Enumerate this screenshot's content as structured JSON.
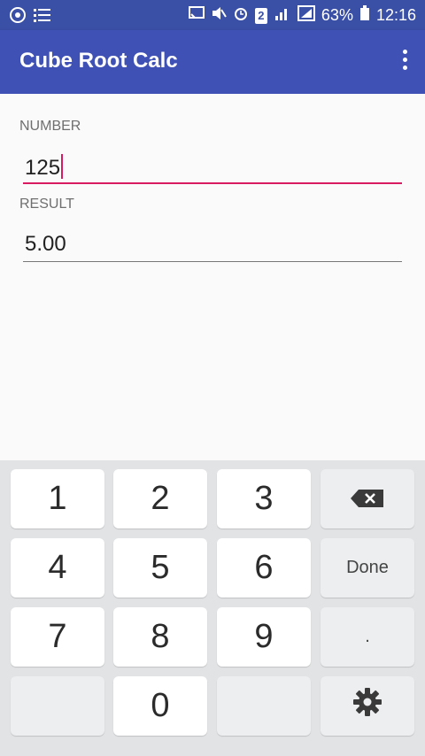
{
  "status_bar": {
    "battery_percent": "63%",
    "time": "12:16",
    "sim_badge": "2"
  },
  "app_bar": {
    "title": "Cube Root Calc"
  },
  "form": {
    "number_label": "NUMBER",
    "number_value": "125",
    "result_label": "RESULT",
    "result_value": "5.00"
  },
  "keyboard": {
    "digits": [
      "1",
      "2",
      "3",
      "4",
      "5",
      "6",
      "7",
      "8",
      "9",
      "0"
    ],
    "done_label": "Done",
    "dot_label": "."
  },
  "colors": {
    "app_bar": "#3f51b5",
    "status_bar": "#3a4fa6",
    "accent": "#d81b60"
  }
}
